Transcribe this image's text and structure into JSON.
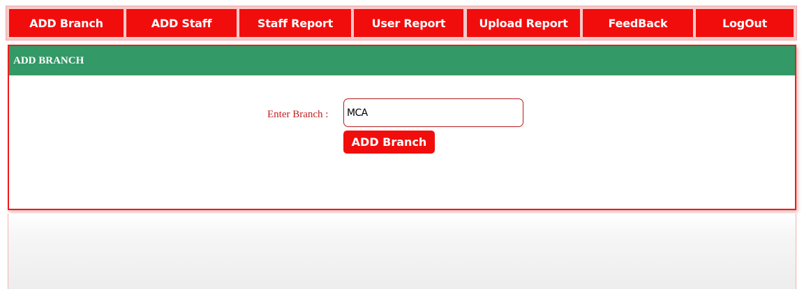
{
  "nav": {
    "items": [
      {
        "label": "ADD Branch"
      },
      {
        "label": "ADD Staff"
      },
      {
        "label": "Staff Report"
      },
      {
        "label": "User Report"
      },
      {
        "label": "Upload Report"
      },
      {
        "label": "FeedBack"
      },
      {
        "label": "LogOut"
      }
    ]
  },
  "panel": {
    "title": "ADD BRANCH",
    "label": "Enter Branch :",
    "input_value": "MCA",
    "button_label": "ADD Branch"
  },
  "colors": {
    "nav_bg": "#f20d0d",
    "header_bg": "#339966",
    "label_text": "#c02020",
    "border": "#ee1c1c"
  }
}
